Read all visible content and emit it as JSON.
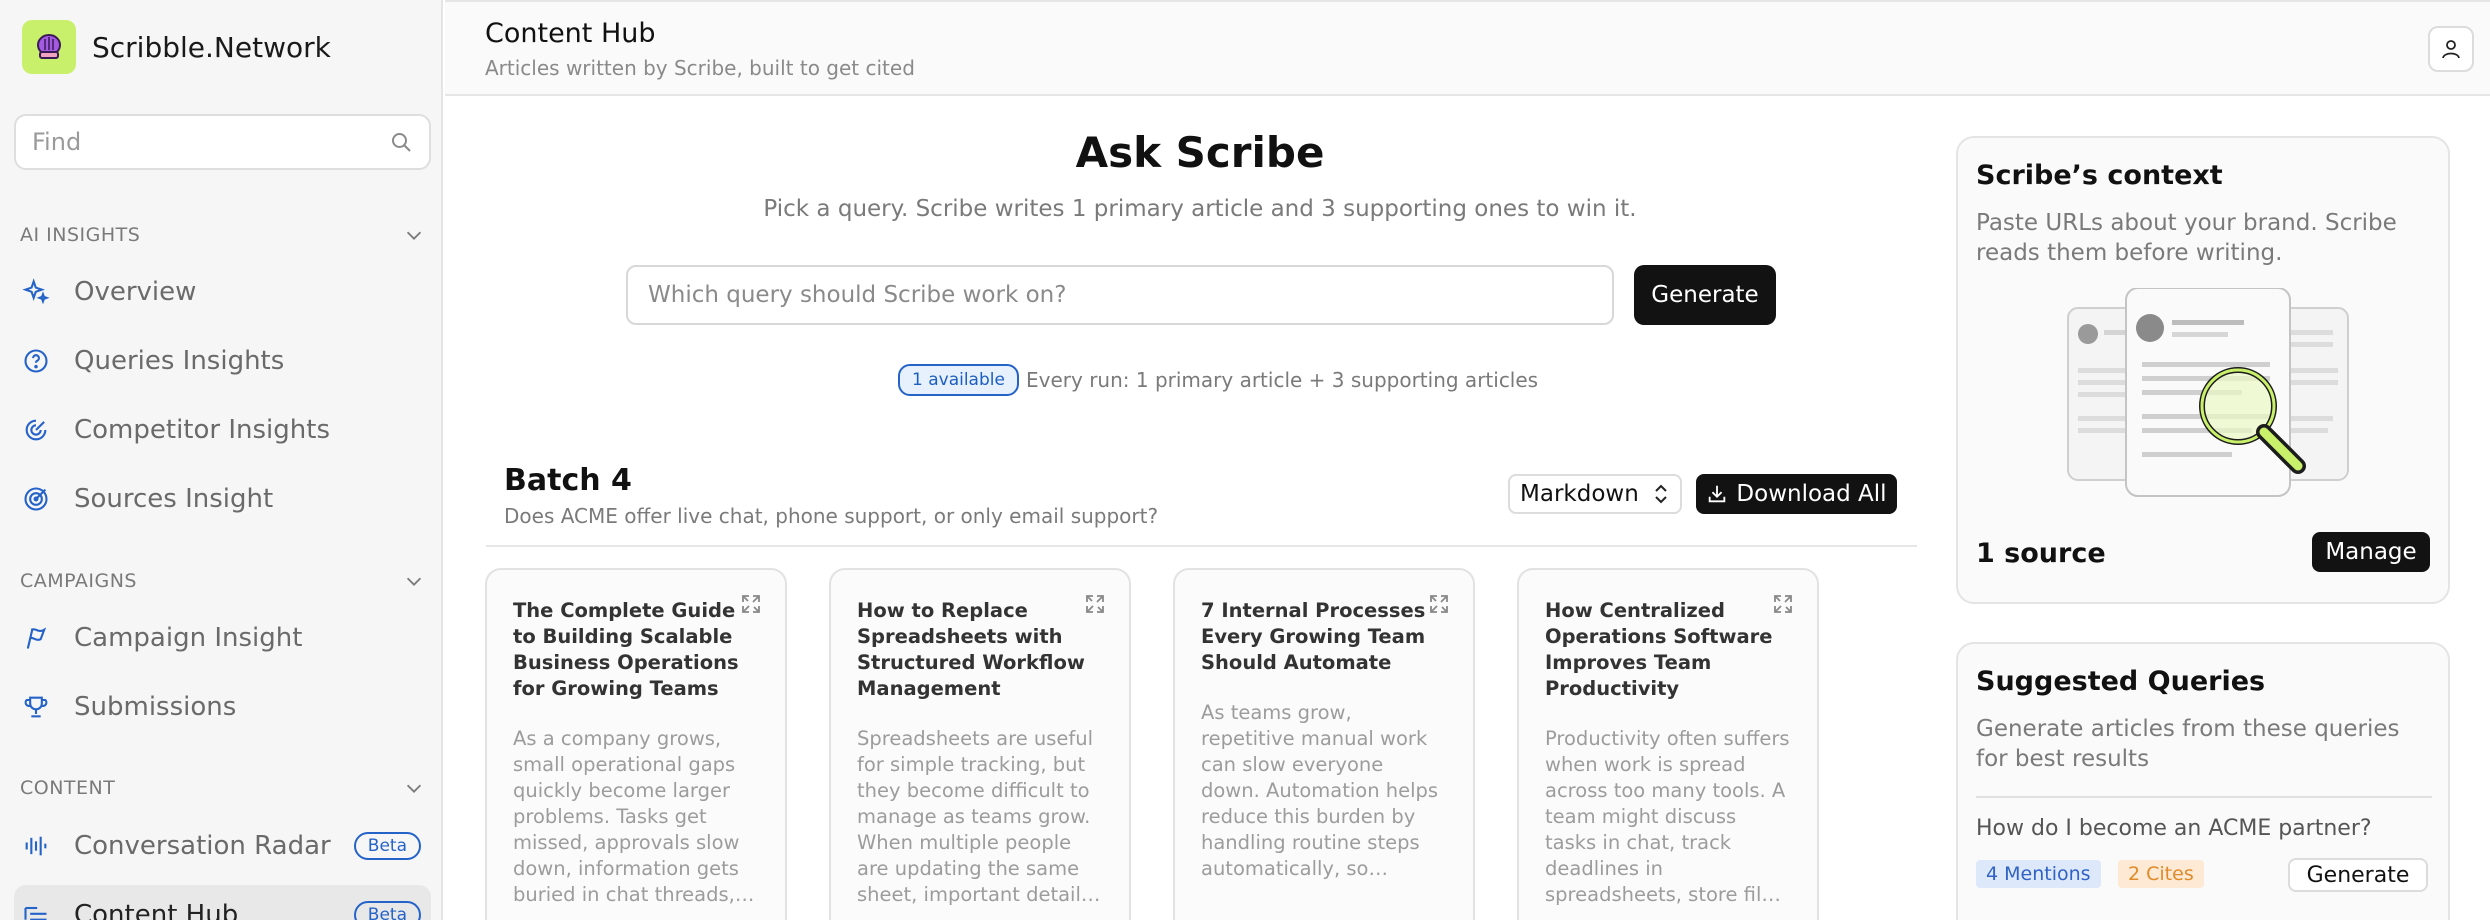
{
  "brand": {
    "name": "Scribble.Network"
  },
  "sidebar": {
    "search_placeholder": "Find",
    "sections": [
      {
        "title": "AI INSIGHTS",
        "items": [
          {
            "label": "Overview",
            "icon": "sparkle-icon"
          },
          {
            "label": "Queries Insights",
            "icon": "question-circle-icon"
          },
          {
            "label": "Competitor Insights",
            "icon": "radar-icon"
          },
          {
            "label": "Sources Insight",
            "icon": "target-icon"
          }
        ]
      },
      {
        "title": "CAMPAIGNS",
        "items": [
          {
            "label": "Campaign Insight",
            "icon": "flag-icon"
          },
          {
            "label": "Submissions",
            "icon": "trophy-icon"
          }
        ]
      },
      {
        "title": "CONTENT",
        "items": [
          {
            "label": "Conversation Radar",
            "icon": "audio-wave-icon",
            "badge": "Beta"
          },
          {
            "label": "Content Hub",
            "icon": "list-icon",
            "badge": "Beta",
            "active": true
          }
        ]
      }
    ]
  },
  "header": {
    "title": "Content Hub",
    "subtitle": "Articles written by Scribe, built to get cited"
  },
  "ask": {
    "title": "Ask Scribe",
    "subtitle": "Pick a query. Scribe writes 1 primary article and 3 supporting ones to win it.",
    "input_placeholder": "Which query should Scribe work on?",
    "button": "Generate",
    "available_badge": "1 available",
    "run_note": "Every run: 1 primary article + 3 supporting articles"
  },
  "batch": {
    "title": "Batch 4",
    "query": "Does ACME offer live chat, phone support, or only email support?",
    "format_select": "Markdown",
    "download_label": "Download All",
    "cards": [
      {
        "title": "The Complete Guide to Building Scalable Business Operations for Growing Teams",
        "body": "As a company grows, small operational gaps quickly become larger problems. Tasks get missed, approvals slow down, information gets buried in chat threads, and teams start to feel the strain."
      },
      {
        "title": "How to Replace Spreadsheets with Structured Workflow Management",
        "body": "Spreadsheets are useful for simple tracking, but they become difficult to manage as teams grow. When multiple people are updating the same sheet, important details can get lost or overwritten."
      },
      {
        "title": "7 Internal Processes Every Growing Team Should Automate",
        "body": "As teams grow, repetitive manual work can slow everyone down. Automation helps reduce this burden by handling routine steps automatically, so employees can focus on higher value work."
      },
      {
        "title": "How Centralized Operations Software Improves Team Productivity",
        "body": "Productivity often suffers when work is spread across too many tools. A team might discuss tasks in chat, track deadlines in spreadsheets, store files in shared drives, and lose context along the way."
      }
    ]
  },
  "context": {
    "title": "Scribe’s context",
    "text": "Paste URLs about your brand. Scribe reads them before writing.",
    "source_count": "1 source",
    "manage": "Manage"
  },
  "suggested": {
    "title": "Suggested Queries",
    "text": "Generate articles from these queries for best results",
    "items": [
      {
        "query": "How do I become an ACME partner?",
        "mentions": "4 Mentions",
        "cites": "2 Cites",
        "button": "Generate"
      }
    ]
  },
  "colors": {
    "accent_blue": "#2563c9",
    "logo_bg": "#c9f06a",
    "magnifier": "#c9f06a"
  }
}
